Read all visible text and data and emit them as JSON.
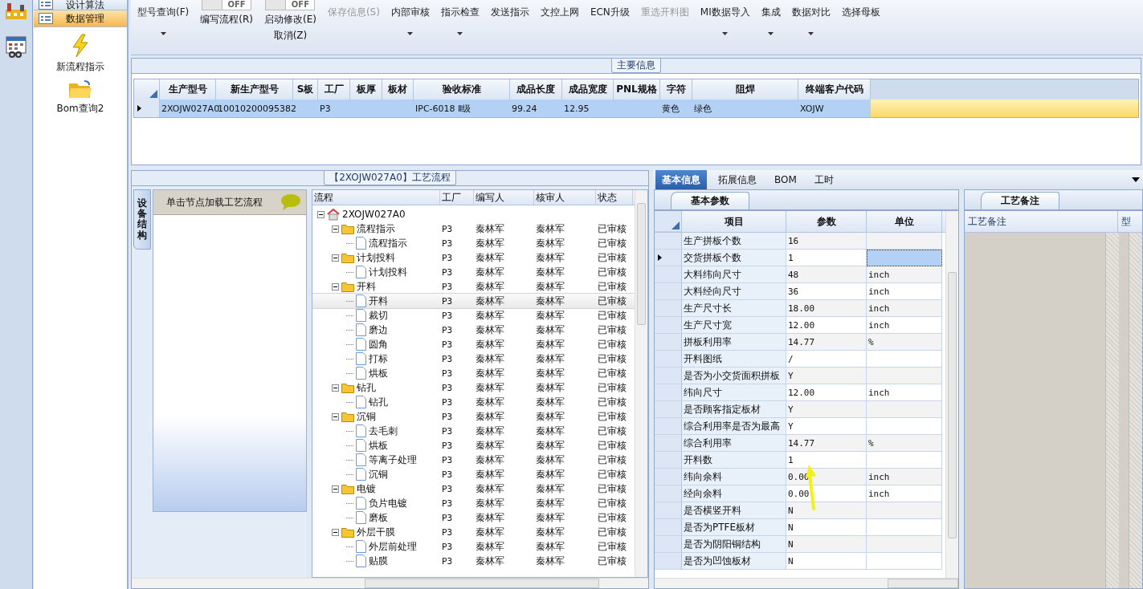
{
  "toolbar": {
    "items": [
      {
        "label": "型号查询(F)",
        "kind": "button",
        "dropdown": true,
        "disabled": false
      },
      {
        "label": "编写流程(R)",
        "kind": "toggle",
        "switch_text": "OFF",
        "on": false
      },
      {
        "label": "启动修改(E)",
        "kind": "toggle",
        "switch_text": "OFF",
        "on": false,
        "sublabel": "取消(Z)"
      },
      {
        "label": "保存信息(S)",
        "kind": "button",
        "dropdown": false,
        "disabled": true
      },
      {
        "label": "内部审核",
        "kind": "button",
        "dropdown": true,
        "disabled": false
      },
      {
        "label": "指示检查",
        "kind": "button",
        "dropdown": true,
        "disabled": false
      },
      {
        "label": "发送指示",
        "kind": "button",
        "dropdown": false,
        "disabled": false
      },
      {
        "label": "文控上网",
        "kind": "button",
        "dropdown": false,
        "disabled": false
      },
      {
        "label": "ECN升级",
        "kind": "button",
        "dropdown": false,
        "disabled": false
      },
      {
        "label": "重选开料图",
        "kind": "button",
        "dropdown": false,
        "disabled": true
      },
      {
        "label": "MI数据导入",
        "kind": "button",
        "dropdown": true,
        "disabled": false
      },
      {
        "label": "集成",
        "kind": "button",
        "dropdown": true,
        "disabled": false
      },
      {
        "label": "数据对比",
        "kind": "button",
        "dropdown": true,
        "disabled": false
      },
      {
        "label": "选择母板",
        "kind": "button",
        "dropdown": false,
        "disabled": false
      }
    ]
  },
  "nav": {
    "sections": [
      {
        "label": "设计算法",
        "selected": false
      },
      {
        "label": "数据管理",
        "selected": true
      }
    ],
    "launchers": [
      {
        "label": "新流程指示",
        "kind": "bolt"
      },
      {
        "label": "Bom查询2",
        "kind": "folder"
      }
    ]
  },
  "main_info": {
    "title": "主要信息",
    "columns": [
      "生产型号",
      "新生产型号",
      "S板",
      "工厂",
      "板厚",
      "板材",
      "验收标准",
      "成品长度",
      "成品宽度",
      "PNL规格",
      "字符",
      "阻焊",
      "终端客户代码"
    ],
    "rows": [
      {
        "selected": true,
        "cells": [
          "2XOJW027A0",
          "10010200095382",
          null,
          "P3",
          null,
          null,
          "IPC-6018 Ⅱ级",
          "99.24",
          "12.95",
          null,
          "黄色",
          "绿色",
          "XOJW"
        ]
      }
    ]
  },
  "process_flow": {
    "title": "【2XOJW027A0】工艺流程",
    "side_tab": "设备结构",
    "hint": "单击节点加载工艺流程",
    "columns": [
      "流程",
      "工厂",
      "编写人",
      "核审人",
      "状态"
    ],
    "tree": [
      {
        "label": "2XOJW027A0",
        "kind": "root",
        "expanded": true,
        "selected": false,
        "children": [
          {
            "label": "流程指示",
            "kind": "folder",
            "expanded": true,
            "selected": false,
            "factory": "P3",
            "writer": "秦林军",
            "reviewer": "秦林军",
            "status": "已审核",
            "children": [
              {
                "label": "流程指示",
                "kind": "step",
                "selected": false,
                "factory": "P3",
                "writer": "秦林军",
                "reviewer": "秦林军",
                "status": "已审核"
              }
            ]
          },
          {
            "label": "计划投料",
            "kind": "folder",
            "expanded": true,
            "selected": false,
            "factory": "P3",
            "writer": "秦林军",
            "reviewer": "秦林军",
            "status": "已审核",
            "children": [
              {
                "label": "计划投料",
                "kind": "step",
                "selected": false,
                "factory": "P3",
                "writer": "秦林军",
                "reviewer": "秦林军",
                "status": "已审核"
              }
            ]
          },
          {
            "label": "开料",
            "kind": "folder",
            "expanded": true,
            "selected": false,
            "factory": "P3",
            "writer": "秦林军",
            "reviewer": "秦林军",
            "status": "已审核",
            "children": [
              {
                "label": "开料",
                "kind": "step",
                "selected": true,
                "factory": "P3",
                "writer": "秦林军",
                "reviewer": "秦林军",
                "status": "已审核"
              },
              {
                "label": "裁切",
                "kind": "step",
                "selected": false,
                "factory": "P3",
                "writer": "秦林军",
                "reviewer": "秦林军",
                "status": "已审核"
              },
              {
                "label": "磨边",
                "kind": "step",
                "selected": false,
                "factory": "P3",
                "writer": "秦林军",
                "reviewer": "秦林军",
                "status": "已审核"
              },
              {
                "label": "圆角",
                "kind": "step",
                "selected": false,
                "factory": "P3",
                "writer": "秦林军",
                "reviewer": "秦林军",
                "status": "已审核"
              },
              {
                "label": "打标",
                "kind": "step",
                "selected": false,
                "factory": "P3",
                "writer": "秦林军",
                "reviewer": "秦林军",
                "status": "已审核"
              },
              {
                "label": "烘板",
                "kind": "step",
                "selected": false,
                "factory": "P3",
                "writer": "秦林军",
                "reviewer": "秦林军",
                "status": "已审核"
              }
            ]
          },
          {
            "label": "钻孔",
            "kind": "folder",
            "expanded": true,
            "selected": false,
            "factory": "P3",
            "writer": "秦林军",
            "reviewer": "秦林军",
            "status": "已审核",
            "children": [
              {
                "label": "钻孔",
                "kind": "step",
                "selected": false,
                "factory": "P3",
                "writer": "秦林军",
                "reviewer": "秦林军",
                "status": "已审核"
              }
            ]
          },
          {
            "label": "沉铜",
            "kind": "folder",
            "expanded": true,
            "selected": false,
            "factory": "P3",
            "writer": "秦林军",
            "reviewer": "秦林军",
            "status": "已审核",
            "children": [
              {
                "label": "去毛刺",
                "kind": "step",
                "selected": false,
                "factory": "P3",
                "writer": "秦林军",
                "reviewer": "秦林军",
                "status": "已审核"
              },
              {
                "label": "烘板",
                "kind": "step",
                "selected": false,
                "factory": "P3",
                "writer": "秦林军",
                "reviewer": "秦林军",
                "status": "已审核"
              },
              {
                "label": "等离子处理",
                "kind": "step",
                "selected": false,
                "factory": "P3",
                "writer": "秦林军",
                "reviewer": "秦林军",
                "status": "已审核"
              },
              {
                "label": "沉铜",
                "kind": "step",
                "selected": false,
                "factory": "P3",
                "writer": "秦林军",
                "reviewer": "秦林军",
                "status": "已审核"
              }
            ]
          },
          {
            "label": "电镀",
            "kind": "folder",
            "expanded": true,
            "selected": false,
            "factory": "P3",
            "writer": "秦林军",
            "reviewer": "秦林军",
            "status": "已审核",
            "children": [
              {
                "label": "负片电镀",
                "kind": "step",
                "selected": false,
                "factory": "P3",
                "writer": "秦林军",
                "reviewer": "秦林军",
                "status": "已审核"
              },
              {
                "label": "磨板",
                "kind": "step",
                "selected": false,
                "factory": "P3",
                "writer": "秦林军",
                "reviewer": "秦林军",
                "status": "已审核"
              }
            ]
          },
          {
            "label": "外层干膜",
            "kind": "folder",
            "expanded": true,
            "selected": false,
            "factory": "P3",
            "writer": "秦林军",
            "reviewer": "秦林军",
            "status": "已审核",
            "children": [
              {
                "label": "外层前处理",
                "kind": "step",
                "selected": false,
                "factory": "P3",
                "writer": "秦林军",
                "reviewer": "秦林军",
                "status": "已审核"
              },
              {
                "label": "贴膜",
                "kind": "step",
                "selected": false,
                "factory": "P3",
                "writer": "秦林军",
                "reviewer": "秦林军",
                "status": "已审核"
              }
            ]
          }
        ]
      }
    ]
  },
  "detail_tabs": [
    {
      "label": "基本信息",
      "selected": true
    },
    {
      "label": "拓展信息",
      "selected": false
    },
    {
      "label": "BOM",
      "selected": false
    },
    {
      "label": "工时",
      "selected": false
    }
  ],
  "basic_params": {
    "tab": "基本参数",
    "columns": [
      "项目",
      "参数",
      "单位"
    ],
    "rows": [
      {
        "item": "生产拼板个数",
        "value": "16",
        "selected": false
      },
      {
        "item": "交货拼板个数",
        "value": "1",
        "selected": true
      },
      {
        "item": "大料纬向尺寸",
        "value": "48",
        "unit": "inch",
        "selected": false
      },
      {
        "item": "大料经向尺寸",
        "value": "36",
        "unit": "inch",
        "selected": false
      },
      {
        "item": "生产尺寸长",
        "value": "18.00",
        "unit": "inch",
        "selected": false
      },
      {
        "item": "生产尺寸宽",
        "value": "12.00",
        "unit": "inch",
        "selected": false
      },
      {
        "item": "拼板利用率",
        "value": "14.77",
        "unit": "%",
        "selected": false
      },
      {
        "item": "开料图纸",
        "value": "/",
        "selected": false
      },
      {
        "item": "是否为小交货面积拼板",
        "value": "Y",
        "selected": false
      },
      {
        "item": "纬向尺寸",
        "value": "12.00",
        "unit": "inch",
        "selected": false
      },
      {
        "item": "是否顾客指定板材",
        "value": "Y",
        "selected": false
      },
      {
        "item": "综合利用率是否为最高",
        "value": "Y",
        "selected": false
      },
      {
        "item": "综合利用率",
        "value": "14.77",
        "unit": "%",
        "selected": false
      },
      {
        "item": "开料数",
        "value": "1",
        "selected": false
      },
      {
        "item": "纬向余料",
        "value": "0.00",
        "unit": "inch",
        "selected": false
      },
      {
        "item": "经向余料",
        "value": "0.00",
        "unit": "inch",
        "selected": false
      },
      {
        "item": "是否横竖开料",
        "value": "N",
        "selected": false
      },
      {
        "item": "是否为PTFE板材",
        "value": "N",
        "selected": false
      },
      {
        "item": "是否为阴阳铜结构",
        "value": "N",
        "selected": false
      },
      {
        "item": "是否为凹蚀板材",
        "value": "N",
        "selected": false
      }
    ]
  },
  "process_notes": {
    "tab": "工艺备注",
    "columns": [
      "工艺备注",
      "型"
    ]
  }
}
